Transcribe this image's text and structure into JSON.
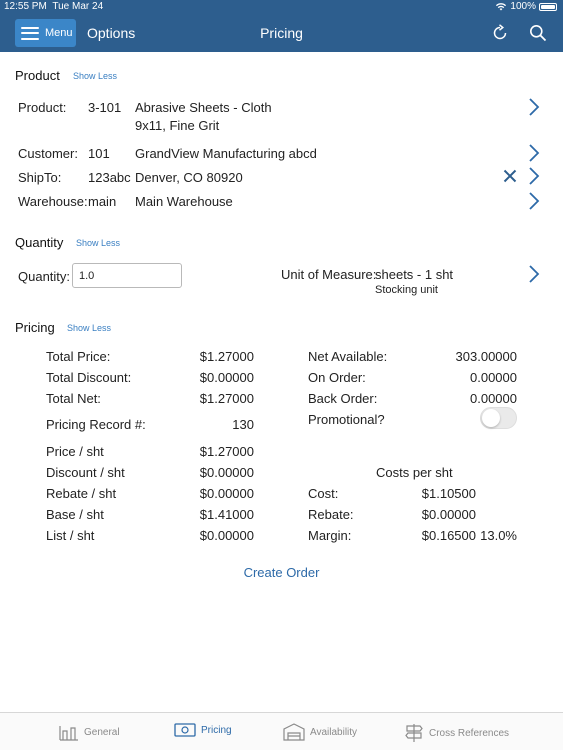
{
  "status": {
    "time": "12:55 PM",
    "date": "Tue Mar 24",
    "battery": "100%"
  },
  "header": {
    "menu_label": "Menu",
    "options_label": "Options",
    "title": "Pricing"
  },
  "product_section": {
    "title": "Product",
    "show_less": "Show Less",
    "product_label": "Product:",
    "product_code": "3-101",
    "product_desc_1": "Abrasive Sheets - Cloth",
    "product_desc_2": "9x11, Fine Grit",
    "customer_label": "Customer:",
    "customer_code": "101",
    "customer_name": "GrandView Manufacturing abcd",
    "shipto_label": "ShipTo:",
    "shipto_code": "123abc",
    "shipto_addr": "Denver, CO 80920",
    "warehouse_label": "Warehouse:",
    "warehouse_code": "main",
    "warehouse_name": "Main Warehouse"
  },
  "quantity_section": {
    "title": "Quantity",
    "show_less": "Show Less",
    "quantity_label": "Quantity:",
    "quantity_value": "1.0",
    "uom_label": "Unit of Measure:",
    "uom_value": "sheets - 1 sht",
    "uom_sub": "Stocking unit"
  },
  "pricing_section": {
    "title": "Pricing",
    "show_less": "Show Less",
    "left_rows": [
      {
        "label": "Total Price:",
        "value": "$1.27000"
      },
      {
        "label": "Total Discount:",
        "value": "$0.00000"
      },
      {
        "label": "Total Net:",
        "value": "$1.27000"
      },
      {
        "label": "Pricing Record #:",
        "value": "130"
      },
      {
        "label": "Price / sht",
        "value": "$1.27000"
      },
      {
        "label": "Discount / sht",
        "value": "$0.00000"
      },
      {
        "label": "Rebate / sht",
        "value": "$0.00000"
      },
      {
        "label": "Base / sht",
        "value": "$1.41000"
      },
      {
        "label": "List / sht",
        "value": "$0.00000"
      }
    ],
    "right_rows": [
      {
        "label": "Net Available:",
        "value": "303.00000"
      },
      {
        "label": "On Order:",
        "value": "0.00000"
      },
      {
        "label": "Back Order:",
        "value": "0.00000"
      }
    ],
    "promotional_label": "Promotional?",
    "promotional_on": false,
    "costs_title": "Costs per sht",
    "costs": [
      {
        "label": "Cost:",
        "value": "$1.10500",
        "extra": ""
      },
      {
        "label": "Rebate:",
        "value": "$0.00000",
        "extra": ""
      },
      {
        "label": "Margin:",
        "value": "$0.16500",
        "extra": "13.0%"
      }
    ]
  },
  "create_order_label": "Create Order",
  "tabs": [
    {
      "label": "General",
      "icon": "general-icon"
    },
    {
      "label": "Pricing",
      "icon": "money-icon"
    },
    {
      "label": "Availability",
      "icon": "warehouse-icon"
    },
    {
      "label": "Cross References",
      "icon": "signpost-icon"
    }
  ],
  "colors": {
    "header": "#2d5e8e",
    "menu_button": "#3b86c8",
    "accent": "#2d6aa8",
    "link": "#3a7fc2"
  }
}
